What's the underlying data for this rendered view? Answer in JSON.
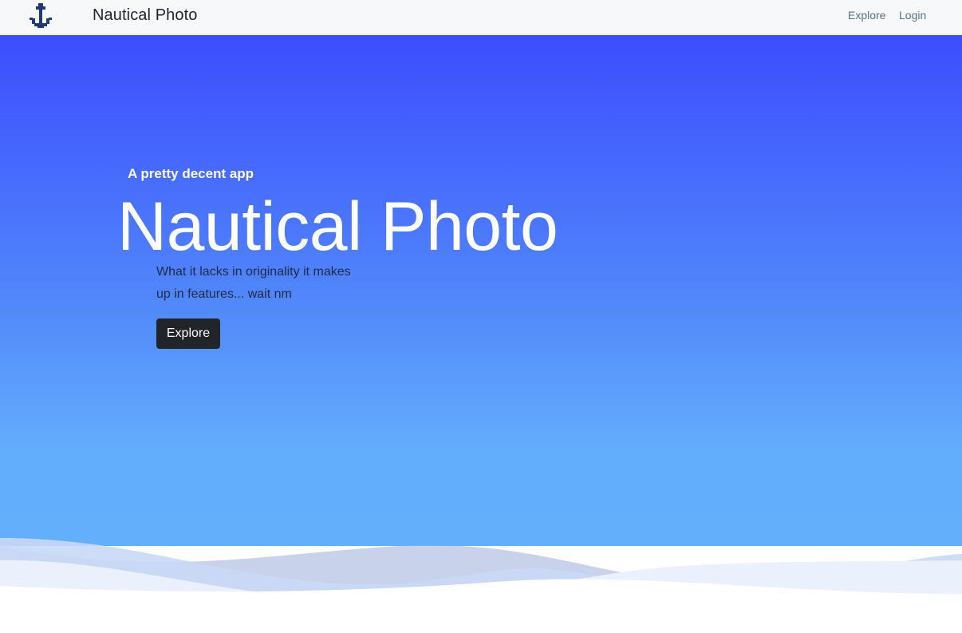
{
  "navbar": {
    "logo_icon": "anchor-icon",
    "brand": "Nautical Photo",
    "links": [
      {
        "label": "Explore"
      },
      {
        "label": "Login"
      }
    ]
  },
  "hero": {
    "tagline": "A pretty decent app",
    "title": "Nautical Photo",
    "description_line1": "What it lacks in originality it makes",
    "description_line2": "up in features... wait nm",
    "button_label": "Explore"
  },
  "colors": {
    "gradient_top": "#3c4dff",
    "gradient_bottom": "#63b0fc",
    "navbar_bg": "#f7f8f9",
    "button_bg": "#212529",
    "logo": "#1f3a7a"
  }
}
